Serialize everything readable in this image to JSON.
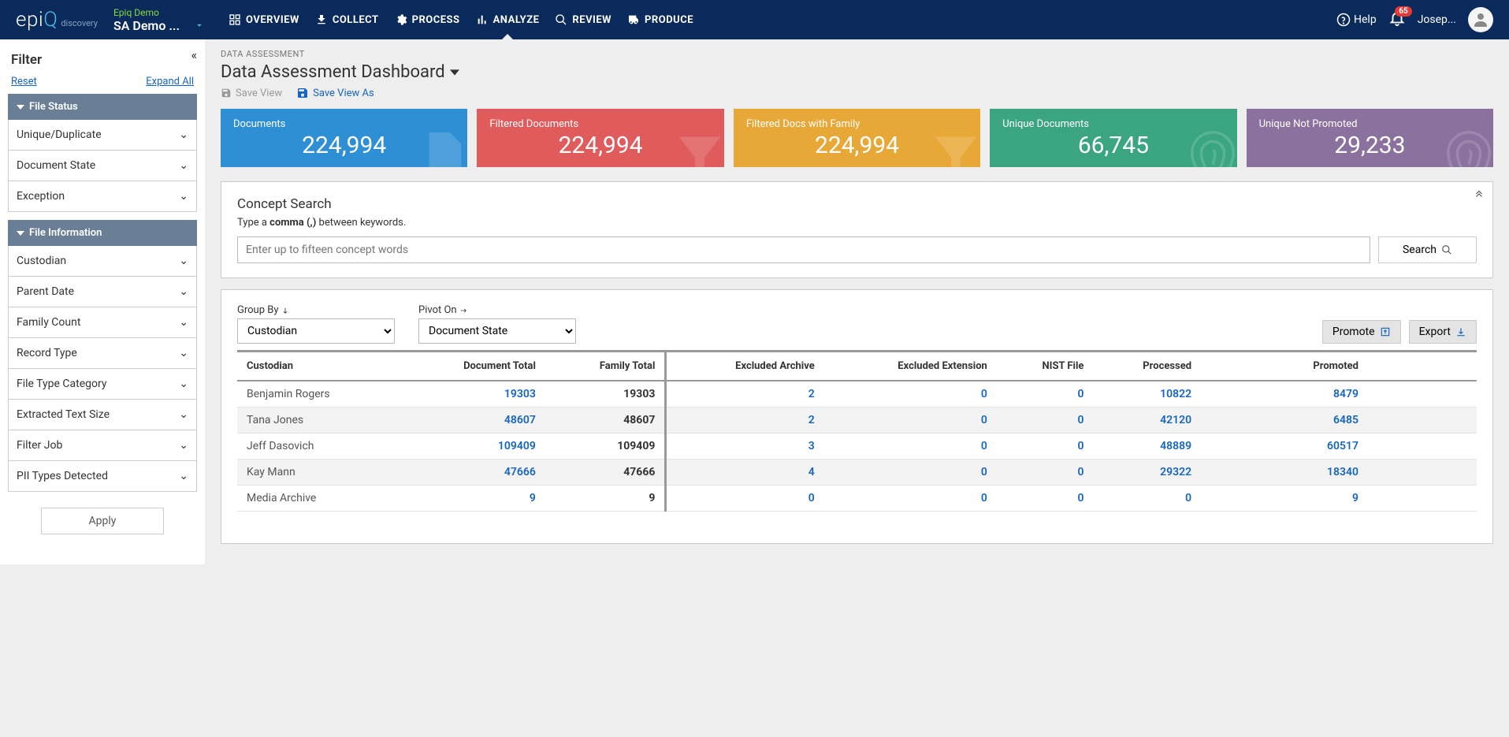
{
  "header": {
    "logo": "epiQ",
    "logo_sub": "discovery",
    "project_name": "Epiq Demo",
    "project_title": "SA Demo ...",
    "nav": [
      {
        "label": "OVERVIEW",
        "active": false
      },
      {
        "label": "COLLECT",
        "active": false
      },
      {
        "label": "PROCESS",
        "active": false
      },
      {
        "label": "ANALYZE",
        "active": true
      },
      {
        "label": "REVIEW",
        "active": false
      },
      {
        "label": "PRODUCE",
        "active": false
      }
    ],
    "help": "Help",
    "notifications": "65",
    "user": "Josep..."
  },
  "sidebar": {
    "title": "Filter",
    "reset": "Reset",
    "expand": "Expand All",
    "groups": [
      {
        "title": "File Status",
        "items": [
          "Unique/Duplicate",
          "Document State",
          "Exception"
        ]
      },
      {
        "title": "File Information",
        "items": [
          "Custodian",
          "Parent Date",
          "Family Count",
          "Record Type",
          "File Type Category",
          "Extracted Text Size",
          "Filter Job",
          "PII Types Detected"
        ]
      }
    ],
    "apply": "Apply"
  },
  "breadcrumb": "DATA ASSESSMENT",
  "page_title": "Data Assessment Dashboard",
  "view_actions": {
    "save_view": "Save View",
    "save_view_as": "Save View As"
  },
  "kpis": [
    {
      "label": "Documents",
      "value": "224,994",
      "color": "blue"
    },
    {
      "label": "Filtered Documents",
      "value": "224,994",
      "color": "red"
    },
    {
      "label": "Filtered Docs with Family",
      "value": "224,994",
      "color": "orange"
    },
    {
      "label": "Unique Documents",
      "value": "66,745",
      "color": "green"
    },
    {
      "label": "Unique Not Promoted",
      "value": "29,233",
      "color": "purple"
    }
  ],
  "concept_search": {
    "title": "Concept Search",
    "hint_prefix": "Type a ",
    "hint_bold": "comma (,)",
    "hint_suffix": " between keywords.",
    "placeholder": "Enter up to fifteen concept words",
    "button": "Search"
  },
  "table_controls": {
    "groupby_label": "Group By",
    "groupby_value": "Custodian",
    "pivot_label": "Pivot On",
    "pivot_value": "Document State",
    "promote": "Promote",
    "export": "Export"
  },
  "table": {
    "columns": [
      "Custodian",
      "Document Total",
      "Family Total",
      "Excluded Archive",
      "Excluded Extension",
      "NIST File",
      "Processed",
      "Promoted"
    ],
    "rows": [
      {
        "c": "Benjamin Rogers",
        "dt": "19303",
        "ft": "19303",
        "ea": "2",
        "ee": "0",
        "nf": "0",
        "pr": "10822",
        "pm": "8479"
      },
      {
        "c": "Tana Jones",
        "dt": "48607",
        "ft": "48607",
        "ea": "2",
        "ee": "0",
        "nf": "0",
        "pr": "42120",
        "pm": "6485"
      },
      {
        "c": "Jeff Dasovich",
        "dt": "109409",
        "ft": "109409",
        "ea": "3",
        "ee": "0",
        "nf": "0",
        "pr": "48889",
        "pm": "60517"
      },
      {
        "c": "Kay Mann",
        "dt": "47666",
        "ft": "47666",
        "ea": "4",
        "ee": "0",
        "nf": "0",
        "pr": "29322",
        "pm": "18340"
      },
      {
        "c": "Media Archive",
        "dt": "9",
        "ft": "9",
        "ea": "0",
        "ee": "0",
        "nf": "0",
        "pr": "0",
        "pm": "9"
      }
    ]
  }
}
